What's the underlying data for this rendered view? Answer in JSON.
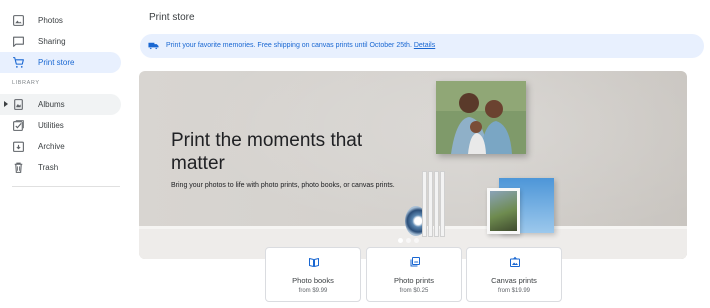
{
  "sidebar": {
    "items": [
      {
        "label": "Photos",
        "icon": "photo-icon"
      },
      {
        "label": "Sharing",
        "icon": "sharing-icon"
      },
      {
        "label": "Print store",
        "icon": "cart-icon",
        "active": true
      }
    ],
    "library_label": "LIBRARY",
    "library_items": [
      {
        "label": "Albums",
        "icon": "album-icon"
      },
      {
        "label": "Utilities",
        "icon": "utilities-icon"
      },
      {
        "label": "Archive",
        "icon": "archive-icon"
      },
      {
        "label": "Trash",
        "icon": "trash-icon"
      }
    ]
  },
  "main": {
    "title": "Print store",
    "banner": {
      "text": "Print your favorite memories. Free shipping on canvas prints until October 25th. ",
      "link": "Details",
      "icon": "truck-icon"
    },
    "hero": {
      "title": "Print the moments that matter",
      "subtitle": "Bring your photos to life with photo prints, photo books, or canvas prints.",
      "slides_total": 3,
      "slide_active": 1
    },
    "products": [
      {
        "name": "Photo books",
        "price": "from $9.99",
        "icon": "photo-book-icon"
      },
      {
        "name": "Photo prints",
        "price": "from $0.25",
        "icon": "photo-prints-icon"
      },
      {
        "name": "Canvas prints",
        "price": "from $19.99",
        "icon": "canvas-icon"
      }
    ]
  },
  "colors": {
    "accent": "#1967d2",
    "active_bg": "#e8f0fe",
    "text": "#3c4043"
  }
}
